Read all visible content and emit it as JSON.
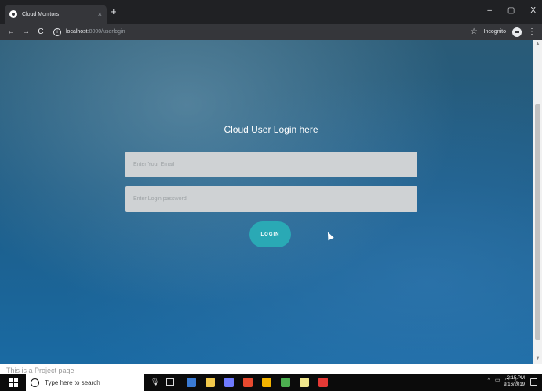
{
  "browser": {
    "tab_title": "Cloud Monitors",
    "tab_close": "×",
    "new_tab": "+",
    "url_host": "localhost",
    "url_path": ":8000/userlogin",
    "incognito_label": "Incognito",
    "window_controls": {
      "minimize": "–",
      "maximize": "▢",
      "close": "X"
    }
  },
  "page": {
    "heading": "Cloud User Login here",
    "email_placeholder": "Enter Your Email",
    "password_placeholder": "Enter Login password",
    "login_button": "LOGIN",
    "footer_text": "This is a Project page"
  },
  "taskbar": {
    "search_placeholder": "Type here to search",
    "time": "2:15 PM",
    "date": "9/16/2019",
    "app_icon_colors": [
      "#3a7bd5",
      "#f2c94c",
      "#6f7bff",
      "#e84a2f",
      "#f4b400",
      "#4caf50",
      "#f0e68c",
      "#e53935"
    ]
  },
  "colors": {
    "login_button": "#2aa9b5",
    "input_bg": "#cfd2d4",
    "background_top": "#2a5b77",
    "background_bottom": "#1a6aa3"
  }
}
